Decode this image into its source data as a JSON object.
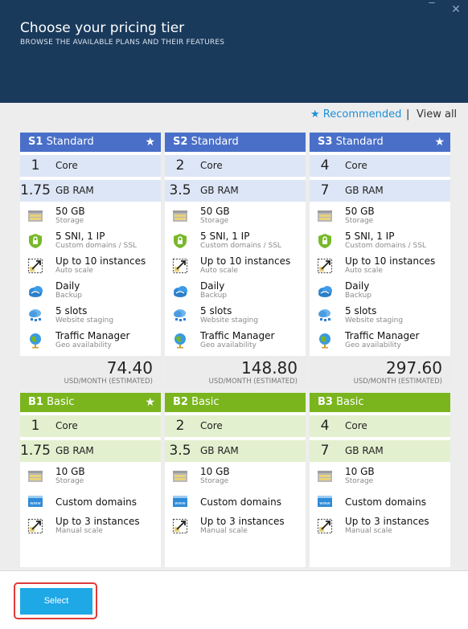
{
  "header": {
    "title": "Choose your pricing tier",
    "subtitle": "BROWSE THE AVAILABLE PLANS AND THEIR FEATURES",
    "minimize": "‾",
    "close": "✕"
  },
  "filter": {
    "recommended": "★ Recommended",
    "separator": "|",
    "view_all": "View all"
  },
  "standard": [
    {
      "code": "S1",
      "name": "Standard",
      "star": "★",
      "core": "1",
      "core_label": "Core",
      "ram": "1.75",
      "ram_label": "GB RAM",
      "features": [
        {
          "icon": "storage-icon",
          "t1": "50 GB",
          "t2": "Storage"
        },
        {
          "icon": "ssl-lock-icon",
          "t1": "5 SNI, 1 IP",
          "t2": "Custom domains / SSL"
        },
        {
          "icon": "scale-icon",
          "t1": "Up to 10 instances",
          "t2": "Auto scale"
        },
        {
          "icon": "backup-cloud-icon",
          "t1": "Daily",
          "t2": "Backup"
        },
        {
          "icon": "staging-icon",
          "t1": "5 slots",
          "t2": "Website staging"
        },
        {
          "icon": "globe-icon",
          "t1": "Traffic Manager",
          "t2": "Geo availability"
        }
      ],
      "price": "74.40",
      "unit": "USD/MONTH (ESTIMATED)"
    },
    {
      "code": "S2",
      "name": "Standard",
      "star": "",
      "core": "2",
      "core_label": "Core",
      "ram": "3.5",
      "ram_label": "GB RAM",
      "features": [
        {
          "icon": "storage-icon",
          "t1": "50 GB",
          "t2": "Storage"
        },
        {
          "icon": "ssl-lock-icon",
          "t1": "5 SNI, 1 IP",
          "t2": "Custom domains / SSL"
        },
        {
          "icon": "scale-icon",
          "t1": "Up to 10 instances",
          "t2": "Auto scale"
        },
        {
          "icon": "backup-cloud-icon",
          "t1": "Daily",
          "t2": "Backup"
        },
        {
          "icon": "staging-icon",
          "t1": "5 slots",
          "t2": "Website staging"
        },
        {
          "icon": "globe-icon",
          "t1": "Traffic Manager",
          "t2": "Geo availability"
        }
      ],
      "price": "148.80",
      "unit": "USD/MONTH (ESTIMATED)"
    },
    {
      "code": "S3",
      "name": "Standard",
      "star": "★",
      "core": "4",
      "core_label": "Core",
      "ram": "7",
      "ram_label": "GB RAM",
      "features": [
        {
          "icon": "storage-icon",
          "t1": "50 GB",
          "t2": "Storage"
        },
        {
          "icon": "ssl-lock-icon",
          "t1": "5 SNI, 1 IP",
          "t2": "Custom domains / SSL"
        },
        {
          "icon": "scale-icon",
          "t1": "Up to 10 instances",
          "t2": "Auto scale"
        },
        {
          "icon": "backup-cloud-icon",
          "t1": "Daily",
          "t2": "Backup"
        },
        {
          "icon": "staging-icon",
          "t1": "5 slots",
          "t2": "Website staging"
        },
        {
          "icon": "globe-icon",
          "t1": "Traffic Manager",
          "t2": "Geo availability"
        }
      ],
      "price": "297.60",
      "unit": "USD/MONTH (ESTIMATED)"
    }
  ],
  "basic": [
    {
      "code": "B1",
      "name": "Basic",
      "star": "★",
      "core": "1",
      "core_label": "Core",
      "ram": "1.75",
      "ram_label": "GB RAM",
      "features": [
        {
          "icon": "storage-icon",
          "t1": "10 GB",
          "t2": "Storage"
        },
        {
          "icon": "web-domain-icon",
          "t1": "Custom domains",
          "t2": ""
        },
        {
          "icon": "scale-icon",
          "t1": "Up to 3 instances",
          "t2": "Manual scale"
        }
      ]
    },
    {
      "code": "B2",
      "name": "Basic",
      "star": "",
      "core": "2",
      "core_label": "Core",
      "ram": "3.5",
      "ram_label": "GB RAM",
      "features": [
        {
          "icon": "storage-icon",
          "t1": "10 GB",
          "t2": "Storage"
        },
        {
          "icon": "web-domain-icon",
          "t1": "Custom domains",
          "t2": ""
        },
        {
          "icon": "scale-icon",
          "t1": "Up to 3 instances",
          "t2": "Manual scale"
        }
      ]
    },
    {
      "code": "B3",
      "name": "Basic",
      "star": "",
      "core": "4",
      "core_label": "Core",
      "ram": "7",
      "ram_label": "GB RAM",
      "features": [
        {
          "icon": "storage-icon",
          "t1": "10 GB",
          "t2": "Storage"
        },
        {
          "icon": "web-domain-icon",
          "t1": "Custom domains",
          "t2": ""
        },
        {
          "icon": "scale-icon",
          "t1": "Up to 3 instances",
          "t2": "Manual scale"
        }
      ]
    }
  ],
  "footer": {
    "select_label": "Select"
  },
  "colors": {
    "header": "#1a3a5c",
    "standard": "#4a6fc8",
    "basic": "#7ab51d",
    "accent": "#1fa8e6"
  }
}
